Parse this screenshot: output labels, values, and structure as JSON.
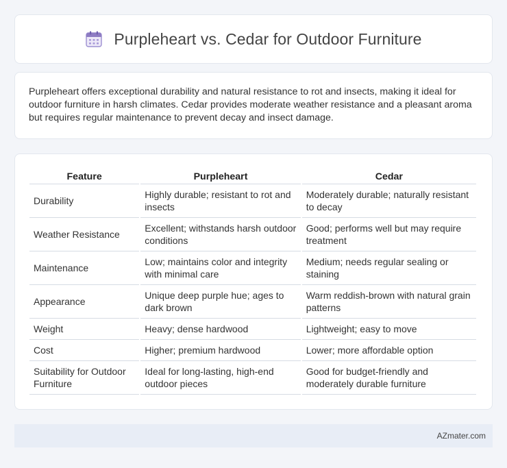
{
  "header": {
    "title": "Purpleheart vs. Cedar for Outdoor Furniture",
    "icon": "calendar-icon"
  },
  "summary": {
    "text": "Purpleheart offers exceptional durability and natural resistance to rot and insects, making it ideal for outdoor furniture in harsh climates. Cedar provides moderate weather resistance and a pleasant aroma but requires regular maintenance to prevent decay and insect damage."
  },
  "table": {
    "headers": [
      "Feature",
      "Purpleheart",
      "Cedar"
    ],
    "rows": [
      [
        "Durability",
        "Highly durable; resistant to rot and insects",
        "Moderately durable; naturally resistant to decay"
      ],
      [
        "Weather Resistance",
        "Excellent; withstands harsh outdoor conditions",
        "Good; performs well but may require treatment"
      ],
      [
        "Maintenance",
        "Low; maintains color and integrity with minimal care",
        "Medium; needs regular sealing or staining"
      ],
      [
        "Appearance",
        "Unique deep purple hue; ages to dark brown",
        "Warm reddish-brown with natural grain patterns"
      ],
      [
        "Weight",
        "Heavy; dense hardwood",
        "Lightweight; easy to move"
      ],
      [
        "Cost",
        "Higher; premium hardwood",
        "Lower; more affordable option"
      ],
      [
        "Suitability for Outdoor Furniture",
        "Ideal for long-lasting, high-end outdoor pieces",
        "Good for budget-friendly and moderately durable furniture"
      ]
    ]
  },
  "footer": {
    "text": "AZmater.com"
  },
  "colors": {
    "page_background": "#f3f5f9",
    "card_background": "#ffffff",
    "footer_background": "#e8edf6",
    "icon_accent": "#8e7cc3"
  }
}
